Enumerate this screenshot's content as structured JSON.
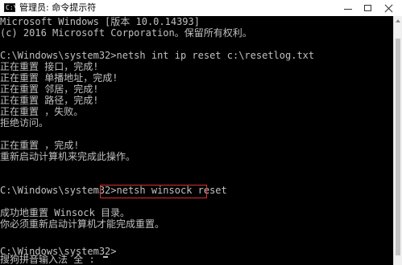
{
  "titlebar": {
    "icon_glyph": "C:\\",
    "title": "管理员: 命令提示符"
  },
  "console": {
    "lines": [
      "Microsoft Windows [版本 10.0.14393]",
      "(c) 2016 Microsoft Corporation。保留所有权利。",
      "",
      "C:\\Windows\\system32>netsh int ip reset c:\\resetlog.txt",
      "正在重置 接口，完成!",
      "正在重置 单播地址，完成!",
      "正在重置 邻居，完成!",
      "正在重置 路径，完成!",
      "正在重置 ，失败。",
      "拒绝访问。",
      "",
      "正在重置 ，完成!",
      "重新启动计算机来完成此操作。",
      "",
      "",
      "C:\\Windows\\system32>netsh winsock reset",
      "",
      "成功地重置 Winsock 目录。",
      "你必须重新启动计算机才能完成重置。",
      "",
      "",
      "C:\\Windows\\system32>",
      "",
      "搜狗拼音输入法 全 :"
    ]
  },
  "colors": {
    "console_bg": "#000000",
    "console_text": "#c0c0c0",
    "highlight_border": "#d93030",
    "titlebar_bg": "#ffffff"
  }
}
